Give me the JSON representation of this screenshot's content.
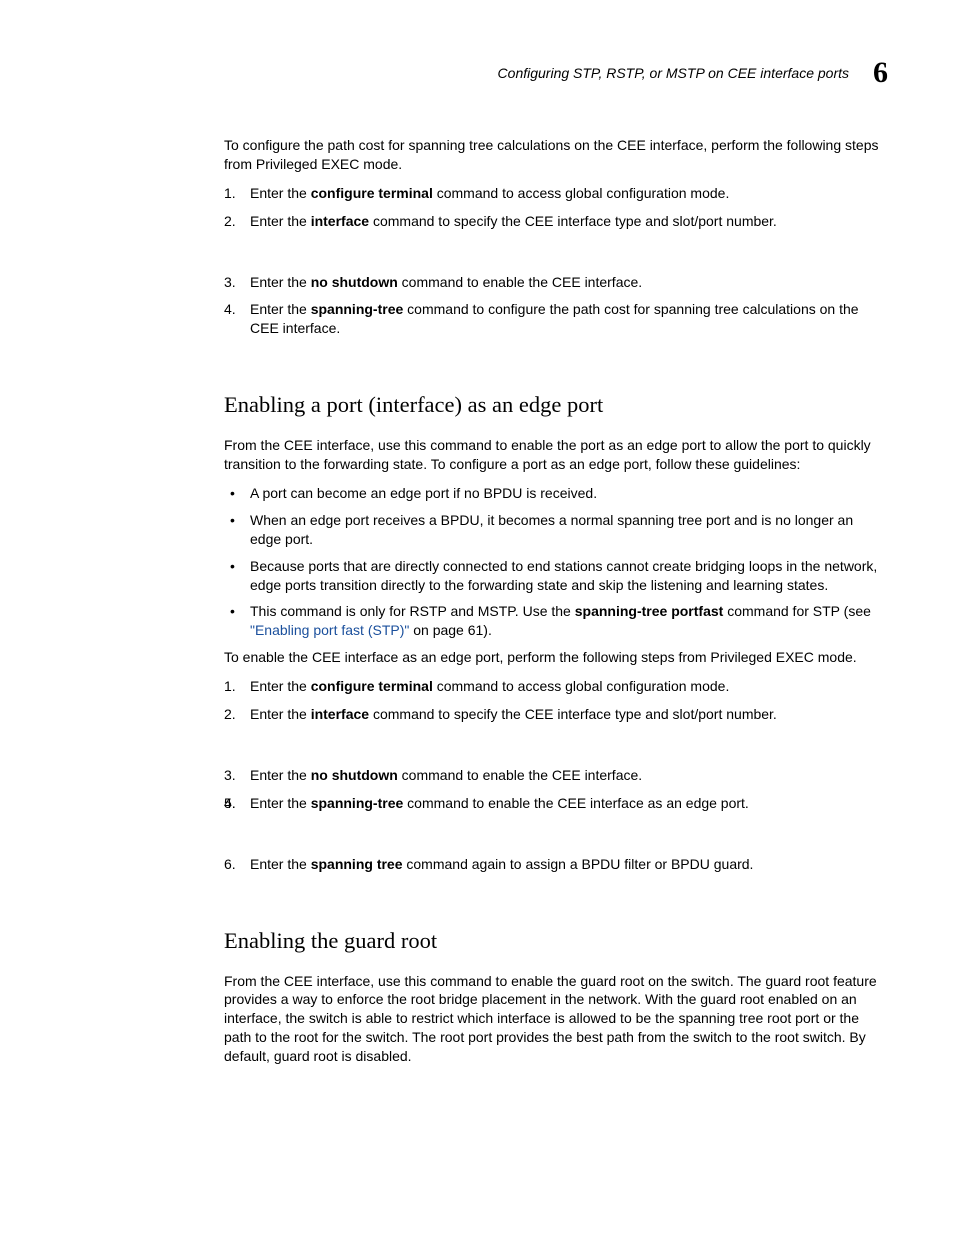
{
  "header": {
    "title": "Configuring STP, RSTP, or MSTP on CEE interface ports",
    "chapter": "6"
  },
  "intro1": "To configure the path cost for spanning tree calculations on the CEE interface, perform the following steps from Privileged EXEC mode.",
  "steps_pathcost": [
    {
      "pre": "Enter the ",
      "cmd": "configure terminal",
      "post": " command to access global configuration mode."
    },
    {
      "pre": "Enter the ",
      "cmd": "interface",
      "post": " command to specify the CEE interface type and slot/port number."
    },
    {
      "pre": "Enter the ",
      "cmd": "no shutdown",
      "post": " command to enable the CEE interface."
    },
    {
      "pre": "Enter the ",
      "cmd": "spanning-tree",
      "post": " command to configure the path cost for spanning tree calculations on the CEE interface."
    }
  ],
  "section_edge": {
    "title": "Enabling a port (interface) as an edge port",
    "intro": "From the CEE interface, use this command to enable the port as an edge port to allow the port to quickly transition to the forwarding state. To configure a port as an edge port, follow these guidelines:",
    "bullets": [
      {
        "text": "A port can become an edge port if no BPDU is received."
      },
      {
        "text": "When an edge port receives a BPDU, it becomes a normal spanning tree port and is no longer an edge port."
      },
      {
        "text": "Because ports that are directly connected to end stations cannot create bridging loops in the network, edge ports transition directly to the forwarding state and skip the listening and learning states."
      },
      {
        "pre": "This command is only for RSTP and MSTP. Use the ",
        "cmd": "spanning-tree portfast",
        "post": " command for STP (see ",
        "link": "\"Enabling port fast (STP)\"",
        "post2": " on page 61)."
      }
    ],
    "intro2": "To enable the CEE interface as an edge port, perform the following steps from Privileged EXEC mode.",
    "steps": [
      {
        "pre": "Enter the ",
        "cmd": "configure terminal",
        "post": " command to access global configuration mode."
      },
      {
        "pre": "Enter the ",
        "cmd": "interface",
        "post": " command to specify the CEE interface type and slot/port number."
      },
      {
        "pre": "Enter the ",
        "cmd": "no shutdown",
        "post": " command to enable the CEE interface."
      },
      {
        "blank": true
      },
      {
        "pre": "Enter the ",
        "cmd": "spanning-tree",
        "post": " command to enable the CEE interface as an edge port."
      },
      {
        "pre": "Enter the ",
        "cmd": "spanning tree",
        "post": " command again to assign a BPDU filter or BPDU guard."
      }
    ]
  },
  "section_guard": {
    "title": "Enabling the guard root",
    "intro": "From the CEE interface, use this command to enable the guard root on the switch. The guard root feature provides a way to enforce the root bridge placement in the network. With the guard root enabled on an interface, the switch is able to restrict which interface is allowed to be the spanning tree root port or the path to the root for the switch. The root port provides the best path from the switch to the root switch. By default, guard root is disabled."
  }
}
